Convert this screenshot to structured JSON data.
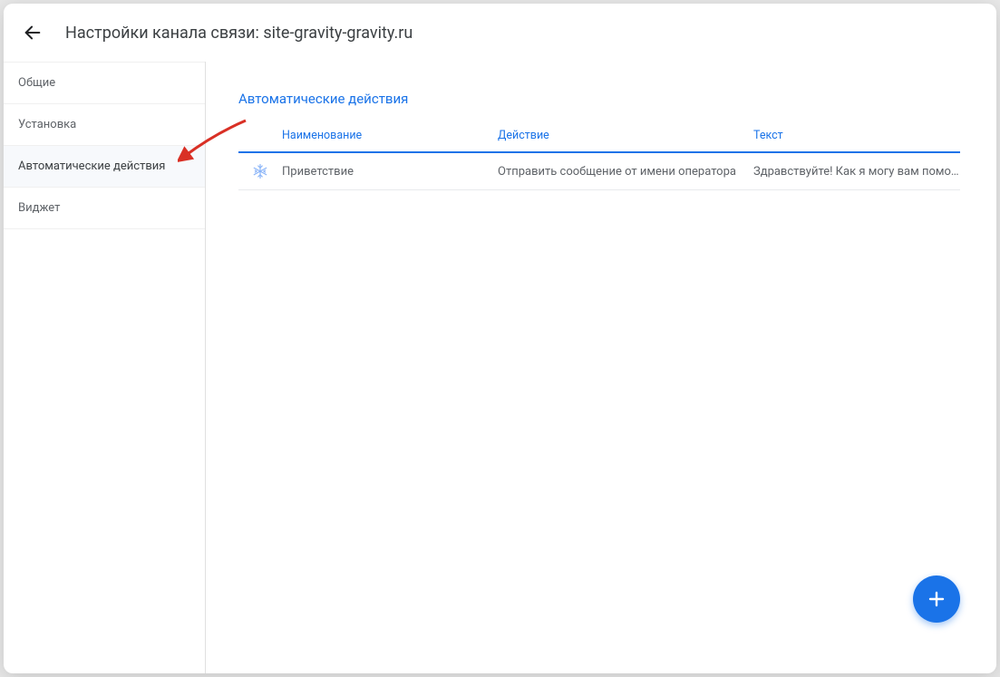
{
  "header": {
    "title": "Настройки канала связи: site-gravity-gravity.ru"
  },
  "sidebar": {
    "items": [
      {
        "label": "Общие",
        "active": false
      },
      {
        "label": "Установка",
        "active": false
      },
      {
        "label": "Автоматические действия",
        "active": true
      },
      {
        "label": "Виджет",
        "active": false
      }
    ]
  },
  "content": {
    "title": "Автоматические действия",
    "columns": {
      "name": "Наименование",
      "action": "Действие",
      "text": "Текст"
    },
    "rows": [
      {
        "name": "Приветствие",
        "action": "Отправить сообщение от имени оператора",
        "text": "Здравствуйте! Как я могу вам помо…"
      }
    ]
  }
}
